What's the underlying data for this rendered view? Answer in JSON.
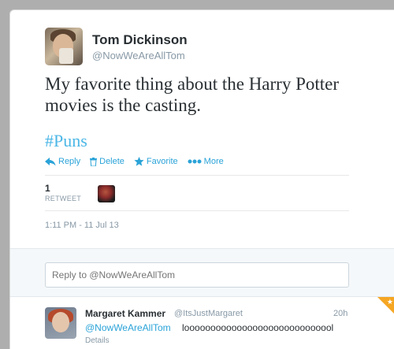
{
  "tweet": {
    "author_name": "Tom Dickinson",
    "author_handle": "@NowWeAreAllTom",
    "text": "My favorite thing about the Harry Potter movies is the casting.",
    "hashtag": "#Puns",
    "timestamp": "1:11 PM - 11 Jul 13"
  },
  "actions": {
    "reply": "Reply",
    "delete": "Delete",
    "favorite": "Favorite",
    "more": "More"
  },
  "stats": {
    "retweet_count": "1",
    "retweet_label": "RETWEET"
  },
  "reply_box": {
    "placeholder": "Reply to @NowWeAreAllTom"
  },
  "reply": {
    "name": "Margaret Kammer",
    "handle": "@ItsJustMargaret",
    "time": "20h",
    "mention": "@NowWeAreAllTom",
    "text": "looooooooooooooooooooooooooool",
    "details": "Details"
  },
  "icons": {
    "reply": "reply-arrow-icon",
    "delete": "trash-icon",
    "favorite": "star-icon",
    "more": "ellipsis-icon",
    "corner": "favorited-star-icon"
  },
  "colors": {
    "link": "#2aa3d8",
    "hashtag": "#4cb7e6",
    "favorited": "#f5a623"
  }
}
